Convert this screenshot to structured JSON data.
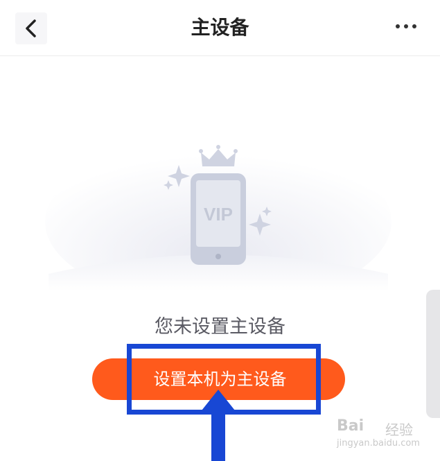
{
  "header": {
    "title": "主设备"
  },
  "icons": {
    "back": "chevron-left-icon",
    "more": "more-dots-icon",
    "illustration": "vip-phone-crown-illustration"
  },
  "illustration": {
    "phone_text": "VIP"
  },
  "empty_state": {
    "message": "您未设置主设备"
  },
  "actions": {
    "set_primary_label": "设置本机为主设备"
  },
  "watermark": {
    "brand": "Bai",
    "text": "经验",
    "url": "jingyan.baidu.com"
  },
  "colors": {
    "accent": "#ff5a1c",
    "highlight": "#1847d4",
    "title": "#222222",
    "message": "#5a5a63"
  }
}
